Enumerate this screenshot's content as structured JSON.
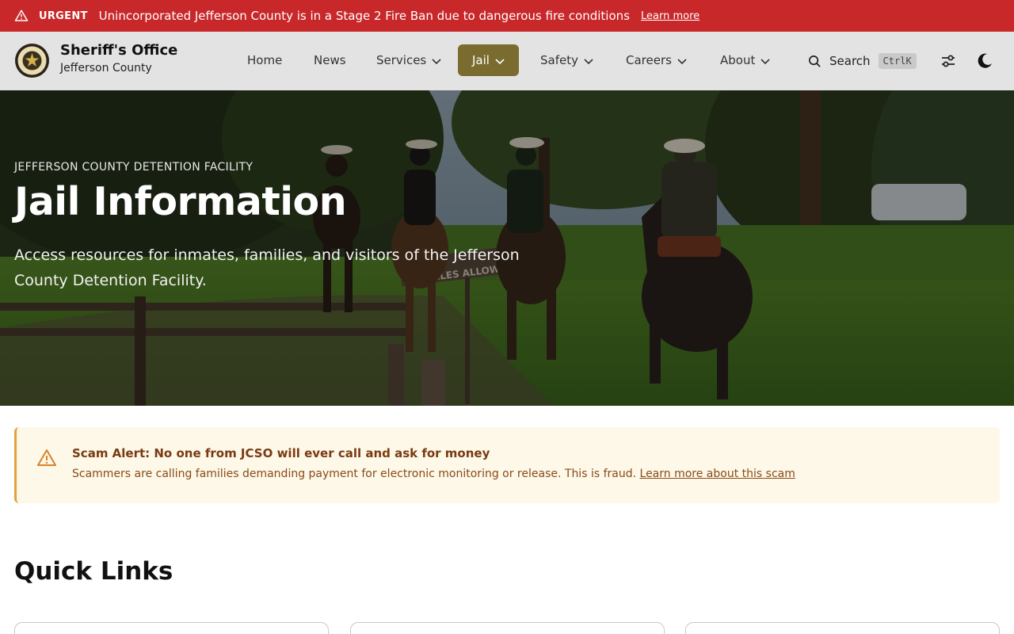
{
  "urgent": {
    "tag": "URGENT",
    "message": "Unincorporated Jefferson County is in a Stage 2 Fire Ban due to dangerous fire conditions",
    "link": "Learn more",
    "color": "#c8282a"
  },
  "brand": {
    "title": "Sheriff's Office",
    "subtitle": "Jefferson County"
  },
  "nav": {
    "items": [
      {
        "label": "Home"
      },
      {
        "label": "News"
      },
      {
        "label": "Services"
      },
      {
        "label": "Jail"
      },
      {
        "label": "Safety"
      },
      {
        "label": "Careers"
      },
      {
        "label": "About"
      }
    ],
    "active": "Jail",
    "active_color": "#7a6c2f",
    "search_label": "Search",
    "search_shortcut": "CtrlK",
    "icons": [
      "search-icon",
      "settings-sliders-icon",
      "dark-mode-moon-icon"
    ]
  },
  "hero": {
    "eyebrow": "JEFFERSON COUNTY DETENTION FACILITY",
    "title": "Jail Information",
    "description": "Access resources for inmates, families, and visitors of the Jefferson County Detention Facility.",
    "sign_text": "VEHICLES ALLOWED"
  },
  "alert": {
    "title": "Scam Alert: No one from JCSO will ever call and ask for money",
    "body": "Scammers are calling families demanding payment for electronic monitoring or release. This is fraud.",
    "link": "Learn more about this scam",
    "accent": "#e0a23a"
  },
  "quick_links": {
    "title": "Quick Links"
  }
}
